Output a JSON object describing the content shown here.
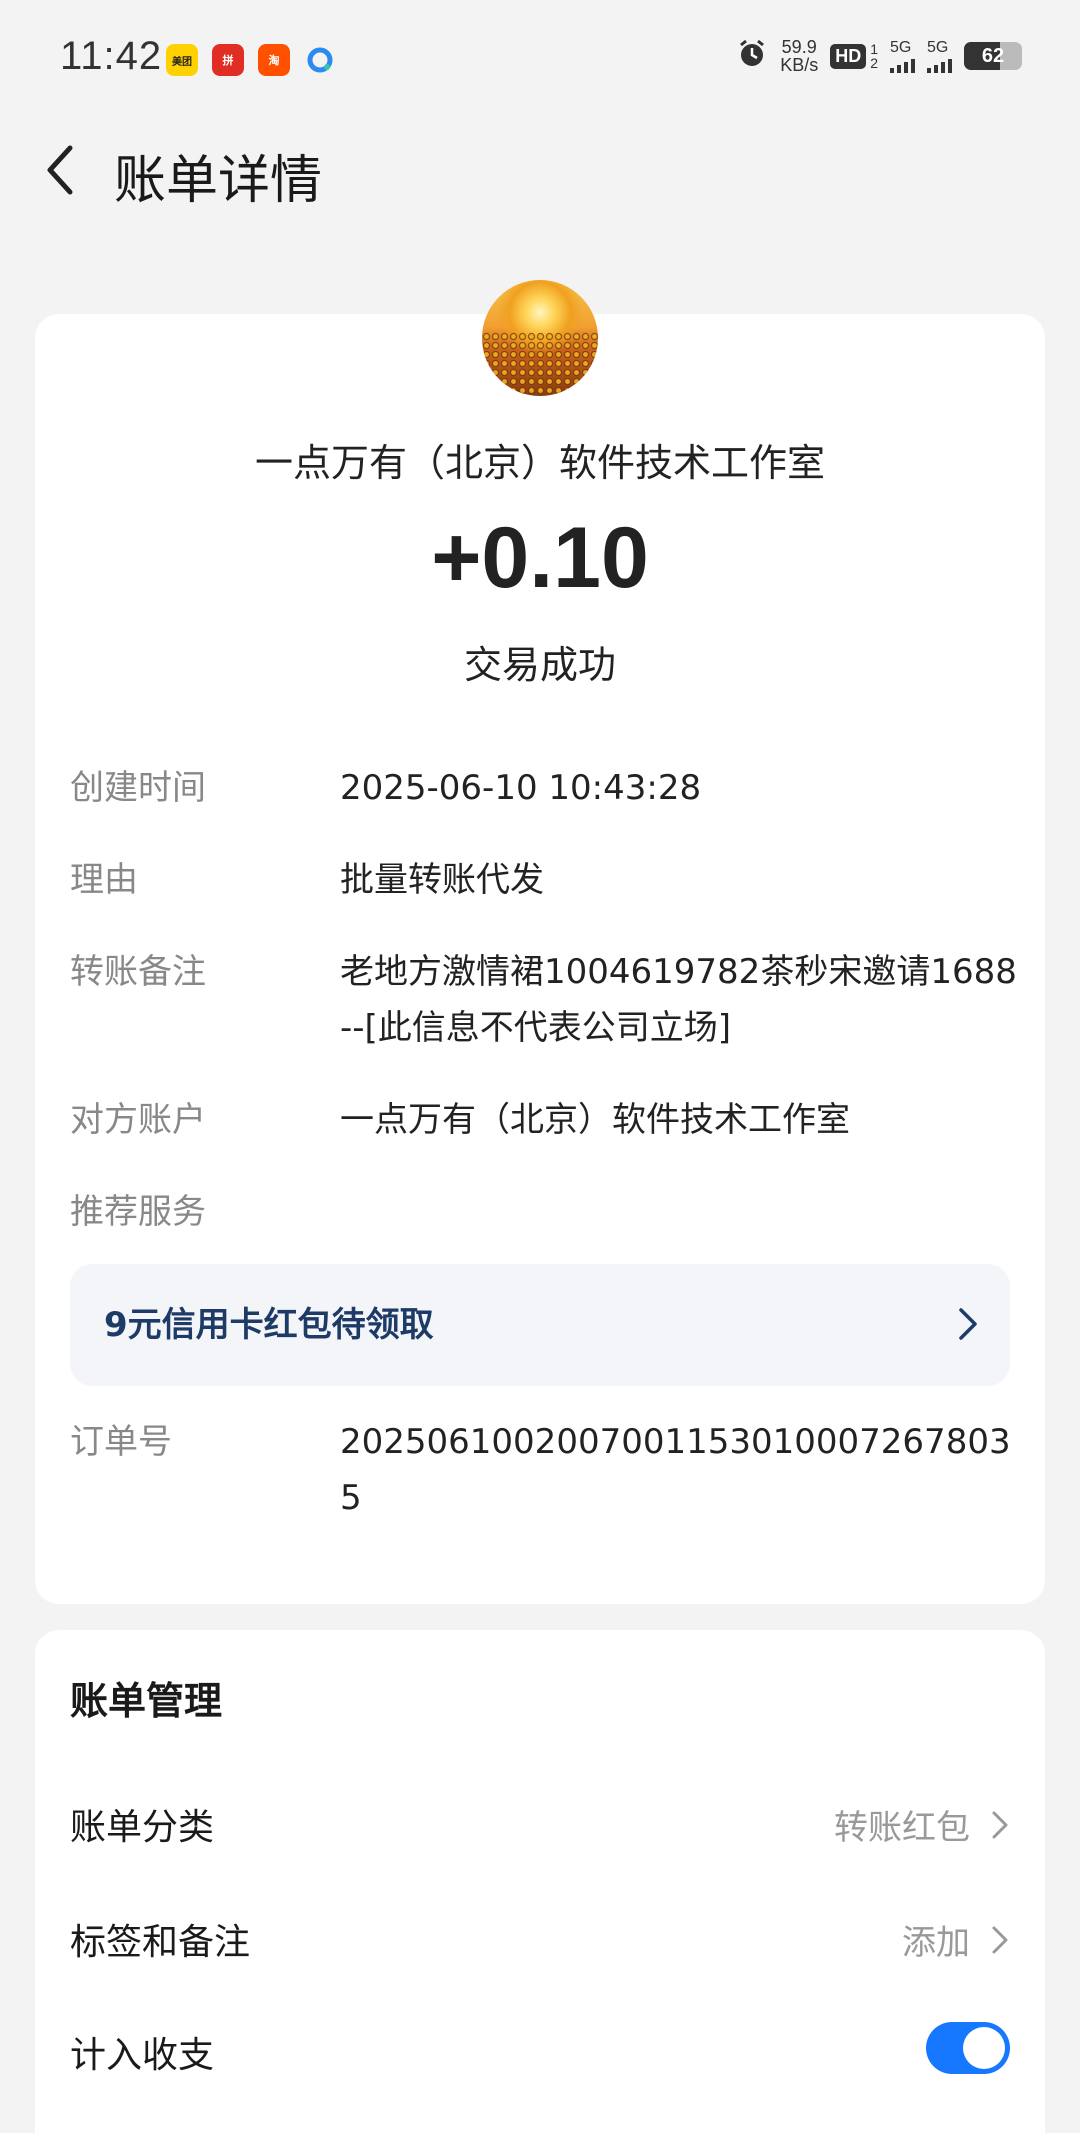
{
  "status_bar": {
    "time": "11:42",
    "apps": [
      "美团",
      "拼",
      "淘",
      "浏览器"
    ],
    "speed_value": "59.9",
    "speed_unit": "KB/s",
    "hd": "HD",
    "sim1_top": "1",
    "sim1_bottom": "2",
    "network1": "5G",
    "network2": "5G",
    "battery": "62",
    "battery_level": 0.62
  },
  "header": {
    "title": "账单详情"
  },
  "transaction": {
    "merchant_name": "一点万有（北京）软件技术工作室",
    "amount": "+0.10",
    "status": "交易成功"
  },
  "details": [
    {
      "label": "创建时间",
      "value": "2025-06-10 10:43:28"
    },
    {
      "label": "理由",
      "value": "批量转账代发"
    },
    {
      "label": "转账备注",
      "value": "老地方激情裙1004619782茶秒宋邀请1688 --[此信息不代表公司立场]"
    },
    {
      "label": "对方账户",
      "value": "一点万有（北京）软件技术工作室"
    },
    {
      "label": "推荐服务",
      "value": ""
    },
    {
      "label": "订单号",
      "value": "20250610020070011530100072678035"
    }
  ],
  "promo": {
    "text": "9元信用卡红包待领取"
  },
  "manage": {
    "title": "账单管理",
    "category_label": "账单分类",
    "category_value": "转账红包",
    "tags_label": "标签和备注",
    "tags_value": "添加",
    "include_label": "计入收支",
    "include_enabled": true
  },
  "colors": {
    "accent": "#1677ff",
    "promo_text": "#1d3b66",
    "background": "#f3f3f3"
  }
}
